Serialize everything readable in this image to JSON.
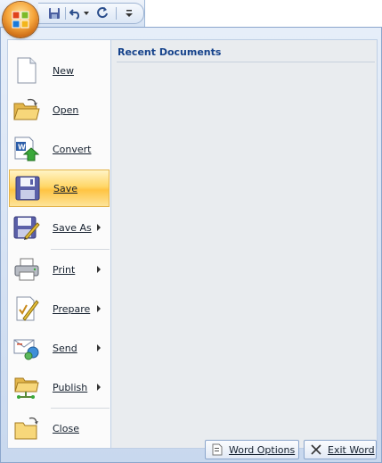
{
  "window": {
    "title": ""
  },
  "quick_access": {
    "items": [
      {
        "name": "save-icon"
      },
      {
        "name": "undo-icon"
      },
      {
        "name": "redo-icon"
      },
      {
        "name": "customize-toolbar-icon"
      }
    ]
  },
  "menu": {
    "items": [
      {
        "label": "New",
        "has_submenu": false
      },
      {
        "label": "Open",
        "has_submenu": false
      },
      {
        "label": "Convert",
        "has_submenu": false
      },
      {
        "label": "Save",
        "has_submenu": false,
        "selected": true
      },
      {
        "label": "Save As",
        "has_submenu": true
      },
      {
        "label": "Print",
        "has_submenu": true
      },
      {
        "label": "Prepare",
        "has_submenu": true
      },
      {
        "label": "Send",
        "has_submenu": true
      },
      {
        "label": "Publish",
        "has_submenu": true
      },
      {
        "label": "Close",
        "has_submenu": false
      }
    ],
    "recent_documents_title": "Recent Documents"
  },
  "footer": {
    "options_label": "Word Options",
    "exit_label": "Exit Word"
  },
  "colors": {
    "accent": "#15428b",
    "selected": "#ffd769",
    "frame": "#8ba6cc"
  }
}
